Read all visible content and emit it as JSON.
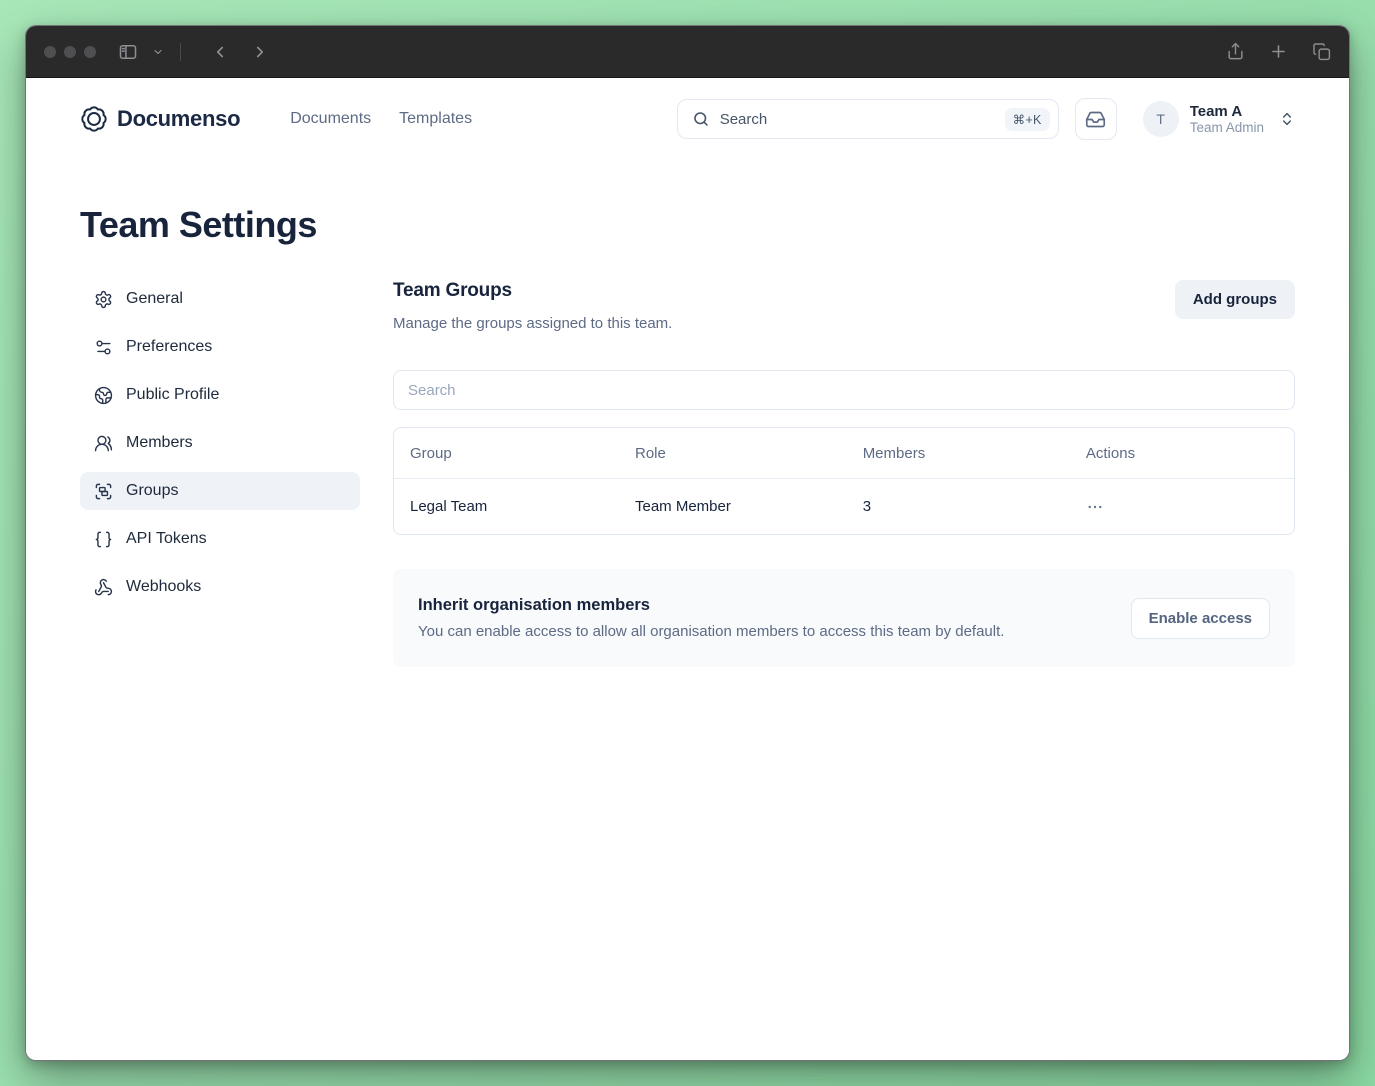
{
  "window": {
    "titlebar": {
      "left_icons": [
        "sidebar-toggle",
        "chevron-down",
        "back",
        "forward"
      ],
      "right_icons": [
        "share",
        "new-tab",
        "tab-overview"
      ]
    }
  },
  "header": {
    "brand": "Documenso",
    "nav": [
      {
        "label": "Documents"
      },
      {
        "label": "Templates"
      }
    ],
    "search": {
      "placeholder": "Search",
      "shortcut": "⌘+K"
    },
    "account": {
      "initial": "T",
      "name": "Team A",
      "role": "Team Admin"
    }
  },
  "page": {
    "title": "Team Settings"
  },
  "sidebar": {
    "items": [
      {
        "label": "General",
        "icon": "gear-icon",
        "active": false
      },
      {
        "label": "Preferences",
        "icon": "sliders-icon",
        "active": false
      },
      {
        "label": "Public Profile",
        "icon": "globe-icon",
        "active": false
      },
      {
        "label": "Members",
        "icon": "users-icon",
        "active": false
      },
      {
        "label": "Groups",
        "icon": "group-icon",
        "active": true
      },
      {
        "label": "API Tokens",
        "icon": "braces-icon",
        "active": false
      },
      {
        "label": "Webhooks",
        "icon": "webhook-icon",
        "active": false
      }
    ]
  },
  "main": {
    "section_title": "Team Groups",
    "section_subtitle": "Manage the groups assigned to this team.",
    "add_button_label": "Add groups",
    "filter_placeholder": "Search",
    "table": {
      "columns": [
        "Group",
        "Role",
        "Members",
        "Actions"
      ],
      "rows": [
        {
          "group": "Legal Team",
          "role": "Team Member",
          "members": "3"
        }
      ]
    },
    "inherit": {
      "title": "Inherit organisation members",
      "description": "You can enable access to allow all organisation members to access this team by default.",
      "button_label": "Enable access"
    }
  },
  "colors": {
    "background_green": "#9be0af",
    "titlebar": "#2a2a2b",
    "brand_navy": "#1b2944",
    "slate_text": "#5d6b85",
    "border": "#e2e8f0",
    "active_item_bg": "#eff3f8",
    "card_bg": "#f8fafc",
    "secondary_btn_bg": "#eef2f6"
  }
}
